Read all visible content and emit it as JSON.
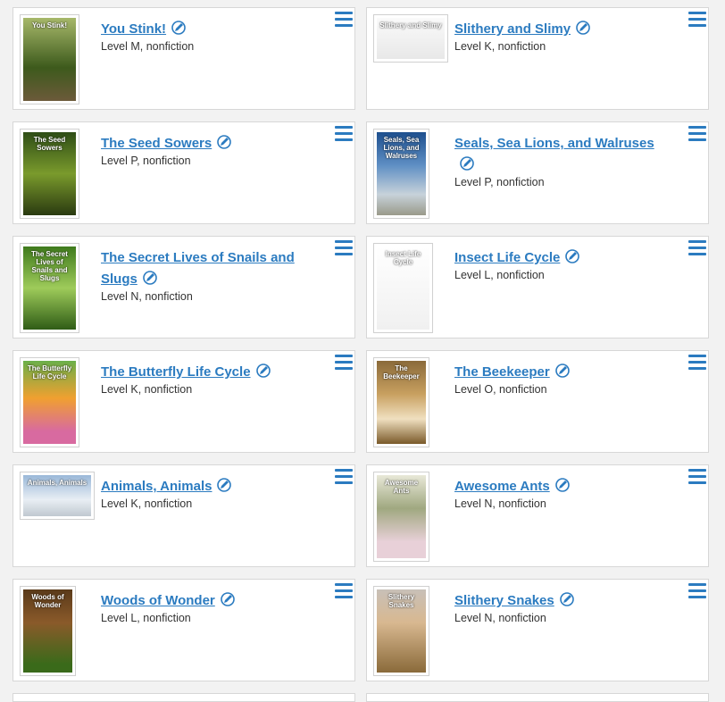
{
  "colors": {
    "link": "#2b7bc0",
    "page_bg": "#f2f2f2",
    "card_border": "#d7d7d7"
  },
  "icons": {
    "edit": "pencil-icon",
    "menu": "hamburger-menu-icon"
  },
  "books": [
    {
      "title": "You Stink!",
      "meta": "Level M, nonfiction",
      "cover_text": "You Stink!"
    },
    {
      "title": "Slithery and Slimy",
      "meta": "Level K, nonfiction",
      "cover_text": "Slithery and Slimy"
    },
    {
      "title": "The Seed Sowers",
      "meta": "Level P, nonfiction",
      "cover_text": "The Seed Sowers"
    },
    {
      "title": "Seals, Sea Lions, and Walruses",
      "meta": "Level P, nonfiction",
      "cover_text": "Seals, Sea Lions, and Walruses"
    },
    {
      "title": "The Secret Lives of Snails and Slugs",
      "meta": "Level N, nonfiction",
      "cover_text": "The Secret Lives of Snails and Slugs"
    },
    {
      "title": "Insect Life Cycle",
      "meta": "Level L, nonfiction",
      "cover_text": "Insect Life Cycle"
    },
    {
      "title": "The Butterfly Life Cycle",
      "meta": "Level K, nonfiction",
      "cover_text": "The Butterfly Life Cycle"
    },
    {
      "title": "The Beekeeper",
      "meta": "Level O, nonfiction",
      "cover_text": "The Beekeeper"
    },
    {
      "title": "Animals, Animals",
      "meta": "Level K, nonfiction",
      "cover_text": "Animals, Animals"
    },
    {
      "title": "Awesome Ants",
      "meta": "Level N, nonfiction",
      "cover_text": "Awesome Ants"
    },
    {
      "title": "Woods of Wonder",
      "meta": "Level L, nonfiction",
      "cover_text": "Woods of Wonder"
    },
    {
      "title": "Slithery Snakes",
      "meta": "Level N, nonfiction",
      "cover_text": "Slithery Snakes"
    }
  ]
}
